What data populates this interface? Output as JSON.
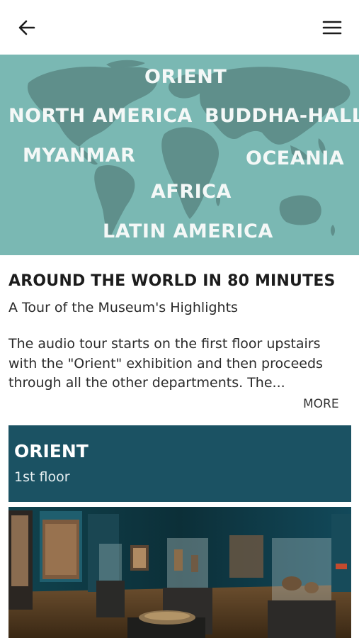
{
  "header": {
    "back_icon": "arrow-left-icon",
    "menu_icon": "hamburger-menu-icon"
  },
  "hero": {
    "regions": {
      "orient": "ORIENT",
      "north_america": "NORTH AMERICA",
      "buddha_hall": "BUDDHA-HALL",
      "myanmar": "MYANMAR",
      "oceania": "OCEANIA",
      "africa": "AFRICA",
      "latin_america": "LATIN AMERICA"
    },
    "background_color": "#7ab8b3"
  },
  "tour": {
    "title": "AROUND THE WORLD IN 80 MINUTES",
    "subtitle": "A Tour of the Museum's Highlights",
    "description": "The audio tour starts on the first floor upstairs with the \"Orient\" exhibition and then proceeds through all the other departments. The...",
    "more_label": "MORE"
  },
  "section": {
    "title": "ORIENT",
    "floor": "1st floor",
    "color": "#1b5263"
  }
}
